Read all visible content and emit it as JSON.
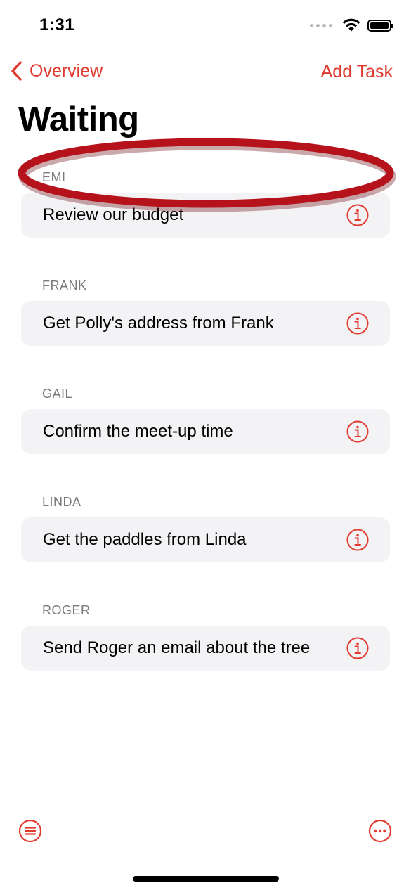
{
  "status_bar": {
    "time": "1:31",
    "icons": [
      "signal-dots-icon",
      "wifi-icon",
      "battery-icon"
    ]
  },
  "nav": {
    "back_label": "Overview",
    "back_icon": "chevron-left-icon",
    "action_label": "Add Task"
  },
  "title": "Waiting",
  "accent_color": "#e03a2f",
  "sections": [
    {
      "header": "EMI",
      "task": "Review our budget"
    },
    {
      "header": "FRANK",
      "task": "Get Polly's address from Frank"
    },
    {
      "header": "GAIL",
      "task": "Confirm the meet-up time"
    },
    {
      "header": "LINDA",
      "task": "Get the paddles from Linda"
    },
    {
      "header": "ROGER",
      "task": "Send Roger an email about the tree"
    }
  ],
  "annotation": {
    "shape": "ellipse",
    "color": "#b5121b",
    "target": "EMI"
  },
  "toolbar": {
    "left_icon": "list-icon",
    "right_icon": "more-options-icon"
  }
}
